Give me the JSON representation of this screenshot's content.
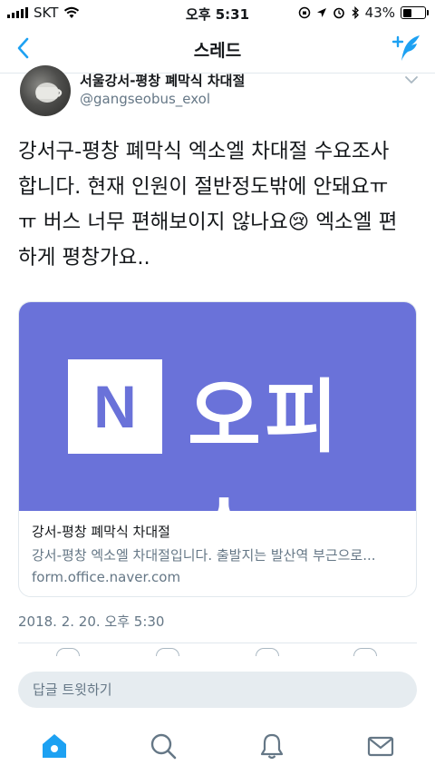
{
  "status": {
    "carrier": "SKT",
    "time": "오후 5:31",
    "battery_text": "43%",
    "battery_level": 0.43
  },
  "nav": {
    "title": "스레드",
    "back_icon": "chevron-left-icon",
    "compose_icon": "compose-tweet-icon"
  },
  "tweet": {
    "author_name": "서울강서-평창 폐막식 차대절",
    "handle": "@gangseobus_exol",
    "lines": [
      "강서구-평창 폐막식 엑소엘 차대절 수요조사",
      "합니다. 현재 인원이 절반정도밖에 안돼요ㅠ",
      "ㅠ 버스 너무 편해보이지 않나요😢 엑소엘 편",
      "하게 평창가요.."
    ],
    "timestamp": "2018. 2. 20. 오후 5:30"
  },
  "card": {
    "logo_letter": "N",
    "logo_text": "오피스",
    "title": "강서-평창 폐막식 차대절",
    "description": "강서-평창 엑소엘 차대절입니다. 출발지는 발산역 부근으로...",
    "domain": "form.office.naver.com"
  },
  "reply": {
    "placeholder": "답글 트윗하기"
  },
  "colors": {
    "accent": "#1da1f2",
    "card_brand": "#6a72d9",
    "muted": "#657786"
  },
  "tabs": [
    {
      "name": "home",
      "icon": "home-icon",
      "active": true
    },
    {
      "name": "search",
      "icon": "search-icon",
      "active": false
    },
    {
      "name": "notifications",
      "icon": "bell-icon",
      "active": false
    },
    {
      "name": "messages",
      "icon": "mail-icon",
      "active": false
    }
  ]
}
